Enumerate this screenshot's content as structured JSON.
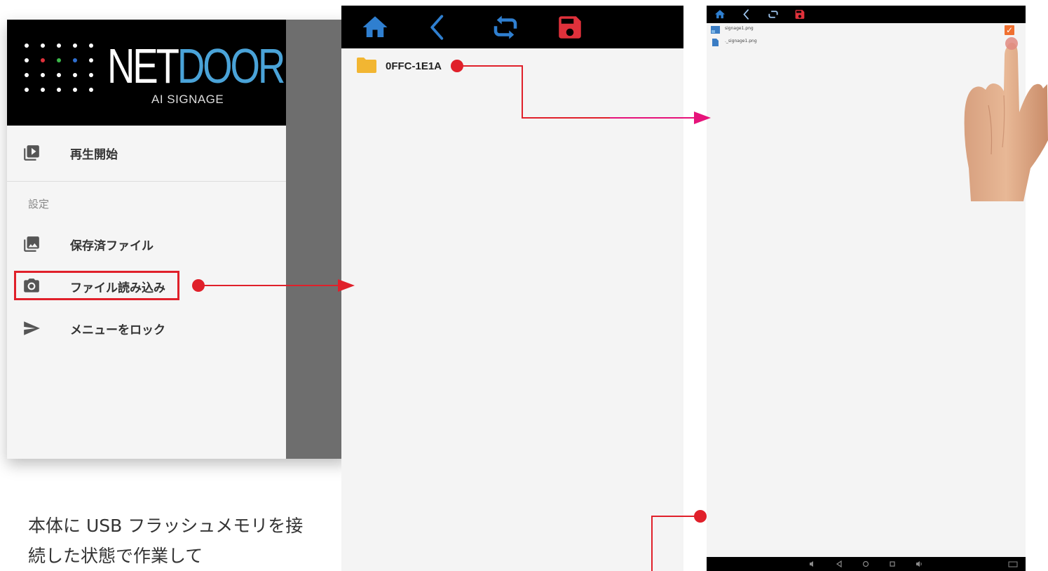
{
  "panel1": {
    "logo": {
      "net": "NET",
      "door": "DOOR",
      "subtitle": "AI SIGNAGE"
    },
    "menu": {
      "play": "再生開始",
      "settings_header": "設定",
      "saved_files": "保存済ファイル",
      "load_files": "ファイル読み込み",
      "lock_menu": "メニューをロック"
    }
  },
  "panel2": {
    "toolbar": {
      "icons": [
        "home-icon",
        "back-icon",
        "refresh-icon",
        "save-icon"
      ]
    },
    "folder": {
      "name": "0FFC-1E1A",
      "icon": "folder-icon"
    }
  },
  "panel3": {
    "files": [
      {
        "name": "signage1.png",
        "icon": "image-file-icon"
      },
      {
        "name": "._signage1.png",
        "icon": "file-icon"
      }
    ],
    "checkbox_checked": true
  },
  "caption": {
    "line1": "本体に USB フラッシュメモリを接",
    "line2": "続した状態で作業して"
  },
  "colors": {
    "accent_blue": "#2f7fd0",
    "save_red": "#e0313b",
    "arrow_red": "#e0202a",
    "arrow_magenta": "#e6137a",
    "logo_blue": "#4aa3d8",
    "checkbox_orange": "#f07030"
  }
}
